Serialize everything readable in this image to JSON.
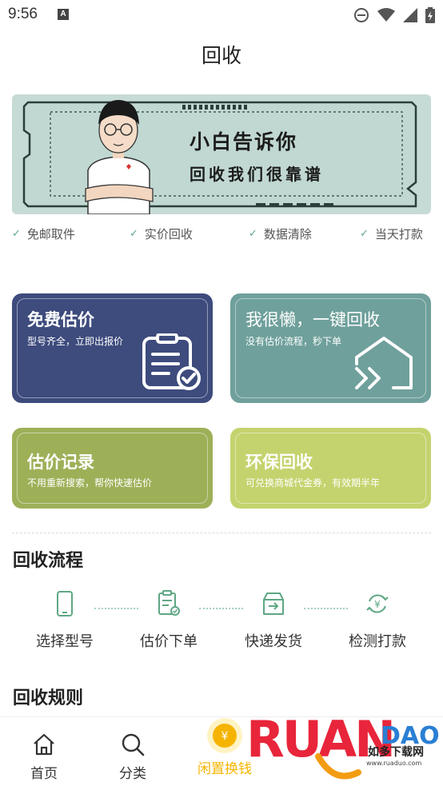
{
  "status": {
    "time": "9:56",
    "notification_letter": "A"
  },
  "header": {
    "title": "回收"
  },
  "banner": {
    "line1": "小白告诉你",
    "line2": "回收我们很靠谱"
  },
  "features": [
    "免邮取件",
    "实价回收",
    "数据清除",
    "当天打款"
  ],
  "cards": [
    {
      "title": "免费估价",
      "subtitle": "型号齐全，立即出报价",
      "color": "#3d4b7d"
    },
    {
      "title": "我很懒，一键回收",
      "subtitle": "没有估价流程，秒下单",
      "color": "#6fa09b"
    },
    {
      "title": "估价记录",
      "subtitle": "不用重新搜索，帮你快速估价",
      "color": "#9db058"
    },
    {
      "title": "环保回收",
      "subtitle": "可兑换商城代金券，有效期半年",
      "color": "#c5d36e"
    }
  ],
  "process": {
    "title": "回收流程",
    "steps": [
      "选择型号",
      "估价下单",
      "快递发货",
      "检测打款"
    ]
  },
  "rules": {
    "title": "回收规则"
  },
  "nav": {
    "items": [
      {
        "label": "首页"
      },
      {
        "label": "分类"
      },
      {
        "label": "闲置换钱"
      }
    ],
    "active_color": "#f5b400"
  },
  "watermark": {
    "brand": "RUANDAO",
    "site_cn": "如多下载网",
    "url": "www.ruaduo.com"
  },
  "colors": {
    "accent_green": "#5fa784"
  }
}
